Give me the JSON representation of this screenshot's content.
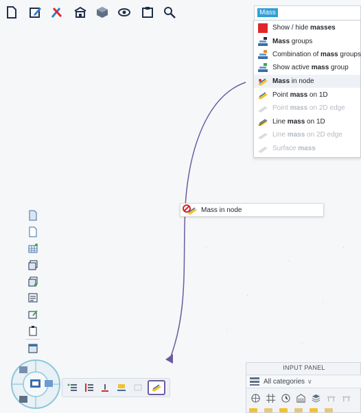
{
  "search": {
    "value": "Mass"
  },
  "results": [
    {
      "pre": "Show / hide ",
      "bold": "masses",
      "post": "",
      "icon": "red-square-icon",
      "enabled": true
    },
    {
      "pre": "",
      "bold": "Mass",
      "post": " groups",
      "icon": "mass-groups-icon",
      "enabled": true
    },
    {
      "pre": "Combination of ",
      "bold": "mass",
      "post": " groups",
      "icon": "mass-combination-icon",
      "enabled": true
    },
    {
      "pre": "Show active ",
      "bold": "mass",
      "post": " group",
      "icon": "active-mass-group-icon",
      "enabled": true
    },
    {
      "pre": "",
      "bold": "Mass",
      "post": " in node",
      "icon": "mass-in-node-icon",
      "enabled": true,
      "highlighted": true
    },
    {
      "pre": "Point ",
      "bold": "mass",
      "post": " on 1D",
      "icon": "point-mass-1d-icon",
      "enabled": true
    },
    {
      "pre": "Point ",
      "bold": "mass",
      "post": " on 2D edge",
      "icon": "point-mass-2d-edge-icon",
      "enabled": false
    },
    {
      "pre": "Line ",
      "bold": "mass",
      "post": " on 1D",
      "icon": "line-mass-1d-icon",
      "enabled": true
    },
    {
      "pre": "Line ",
      "bold": "mass",
      "post": " on 2D edge",
      "icon": "line-mass-2d-edge-icon",
      "enabled": false
    },
    {
      "pre": "Surface ",
      "bold": "mass",
      "post": "",
      "icon": "surface-mass-icon",
      "enabled": false
    }
  ],
  "tooltip": {
    "label": "Mass in node"
  },
  "input_panel": {
    "title": "INPUT PANEL",
    "category": "All categories",
    "chevron": "∨"
  },
  "colors": {
    "highlight": "#2f9fd5",
    "arrow": "#6b5aa0",
    "show_hide_square": "#e0262b"
  },
  "icons": {
    "toolbar": [
      "new-document-icon",
      "edit-document-icon",
      "tools-icon",
      "structure-icon",
      "cube-view-icon",
      "eye-icon",
      "clipboard-icon",
      "search-zoom-icon"
    ],
    "sidebar": [
      "page-icon",
      "page-blank-icon",
      "table-icon",
      "layers-icon",
      "copy-layers-icon",
      "report-icon",
      "document-edit-icon",
      "clipboard-page-icon",
      "window-icon"
    ],
    "subbar": [
      "list-icon",
      "split-list-icon",
      "support-icon",
      "load-icon",
      "blank-icon",
      "mass-in-node-icon"
    ],
    "input_panel": [
      "rotate-icon",
      "grid-icon",
      "clock-icon",
      "building-icon",
      "layers-icon",
      "beam-icon",
      "beam-icon"
    ]
  }
}
